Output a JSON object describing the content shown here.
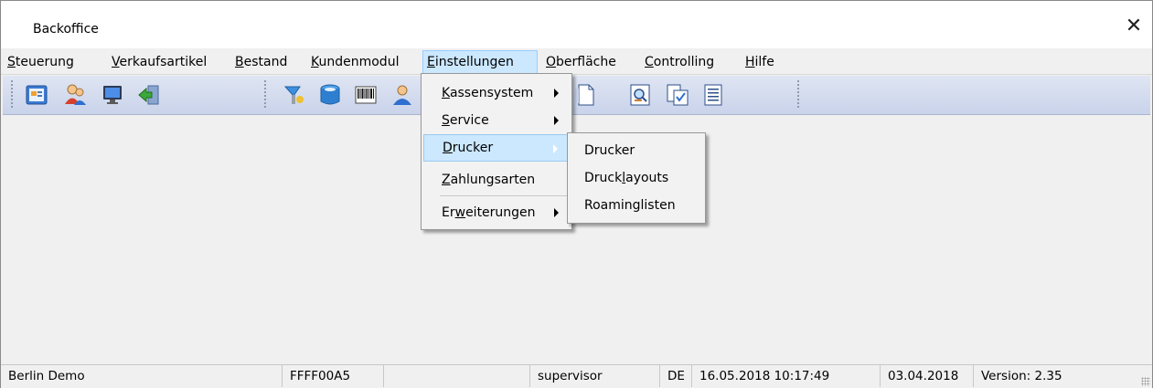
{
  "window": {
    "title": "Backoffice",
    "close_glyph": "✕"
  },
  "menubar": {
    "items": [
      {
        "pre": "",
        "key": "S",
        "post": "teuerung"
      },
      {
        "pre": "",
        "key": "V",
        "post": "erkaufsartikel"
      },
      {
        "pre": "",
        "key": "B",
        "post": "estand"
      },
      {
        "pre": "",
        "key": "K",
        "post": "undenmodul"
      },
      {
        "pre": "",
        "key": "E",
        "post": "instellungen"
      },
      {
        "pre": "",
        "key": "O",
        "post": "berfläche"
      },
      {
        "pre": "",
        "key": "C",
        "post": "ontrolling"
      },
      {
        "pre": "",
        "key": "H",
        "post": "ilfe"
      }
    ]
  },
  "toolbar": {
    "icons": [
      "catalog-icon",
      "users-icon",
      "monitor-icon",
      "exit-icon",
      "wizard-icon",
      "database-icon",
      "barcode-icon",
      "person-icon",
      "document-icon",
      "preview-icon",
      "checked-document-icon",
      "list-document-icon"
    ]
  },
  "einstellungen_menu": {
    "items": [
      {
        "pre": "",
        "key": "K",
        "post": "assensystem",
        "submenu": true
      },
      {
        "pre": "",
        "key": "S",
        "post": "ervice",
        "submenu": true
      },
      {
        "pre": "",
        "key": "D",
        "post": "rucker",
        "submenu": true
      },
      {
        "pre": "",
        "key": "Z",
        "post": "ahlungsarten",
        "submenu": false
      },
      {
        "pre": "Er",
        "key": "w",
        "post": "eiterungen",
        "submenu": true
      }
    ]
  },
  "drucker_submenu": {
    "items": [
      {
        "pre": "Drucker",
        "key": "",
        "post": ""
      },
      {
        "pre": "Druck",
        "key": "l",
        "post": "ayouts"
      },
      {
        "pre": "Roaminglisten",
        "key": "",
        "post": ""
      }
    ]
  },
  "statusbar": {
    "company": "Berlin Demo",
    "code": "FFFF00A5",
    "empty": "",
    "user": "supervisor",
    "language": "DE",
    "datetime": "16.05.2018 10:17:49",
    "date": "03.04.2018",
    "version": "Version: 2.35"
  },
  "colors": {
    "menu_active": "#cce8ff",
    "toolbar_top": "#dfe5f3",
    "toolbar_bottom": "#c9d3ea"
  }
}
